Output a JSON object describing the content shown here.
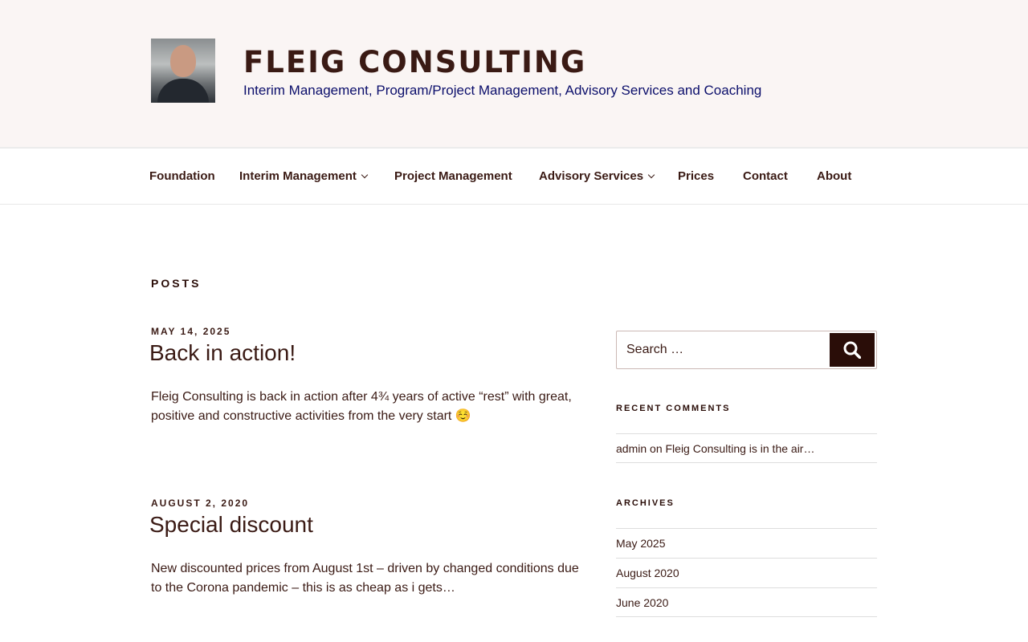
{
  "header": {
    "title": "FLEIG CONSULTING",
    "tagline": "Interim Management, Program/Project Management, Advisory Services and Coaching"
  },
  "nav": {
    "items": [
      {
        "label": "Foundation"
      },
      {
        "label": "Interim Management",
        "has_dropdown": true
      },
      {
        "label": "Project Management"
      },
      {
        "label": "Advisory Services",
        "has_dropdown": true
      },
      {
        "label": "Prices"
      },
      {
        "label": "Contact"
      },
      {
        "label": "About"
      }
    ]
  },
  "main": {
    "heading": "POSTS",
    "posts": [
      {
        "date": "MAY 14, 2025",
        "title": "Back in action!",
        "excerpt": "Fleig Consulting is back in action after 4¾ years of active “rest” with great, positive and constructive activities from the very start ☺️"
      },
      {
        "date": "AUGUST 2, 2020",
        "title": "Special discount",
        "excerpt": "New discounted prices from August 1st – driven by changed conditions due to the Corona pandemic – this is as cheap as i gets…"
      }
    ]
  },
  "sidebar": {
    "search": {
      "placeholder": "Search …",
      "button_icon": "search-icon"
    },
    "recent_comments": {
      "title": "RECENT COMMENTS",
      "items": [
        {
          "author": "admin",
          "connector": "on",
          "post": "Fleig Consulting is in the air…"
        }
      ]
    },
    "archives": {
      "title": "ARCHIVES",
      "items": [
        "May 2025",
        "August 2020",
        "June 2020"
      ]
    }
  },
  "colors": {
    "title": "#0b0e6b",
    "date": "#b03a2e",
    "text": "#3a1a14",
    "header_bg": "#faf5f4"
  }
}
